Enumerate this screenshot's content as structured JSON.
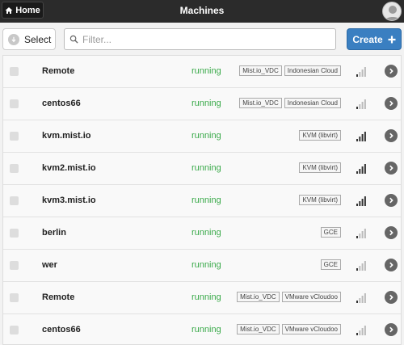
{
  "header": {
    "home_label": "Home",
    "title": "Machines",
    "avatar_icon": "user-avatar-icon"
  },
  "toolbar": {
    "select_label": "Select",
    "filter_placeholder": "Filter...",
    "create_label": "Create"
  },
  "colors": {
    "running": "#3aaa4a",
    "create": "#3a7fc1",
    "header": "#2b2b2b"
  },
  "machines": [
    {
      "name": "Remote",
      "state": "running",
      "tags": [
        "Mist.io_VDC",
        "Indonesian Cloud"
      ],
      "signal": 1
    },
    {
      "name": "centos66",
      "state": "running",
      "tags": [
        "Mist.io_VDC",
        "Indonesian Cloud"
      ],
      "signal": 1
    },
    {
      "name": "kvm.mist.io",
      "state": "running",
      "tags": [
        "KVM (libvirt)"
      ],
      "signal": 4
    },
    {
      "name": "kvm2.mist.io",
      "state": "running",
      "tags": [
        "KVM (libvirt)"
      ],
      "signal": 4
    },
    {
      "name": "kvm3.mist.io",
      "state": "running",
      "tags": [
        "KVM (libvirt)"
      ],
      "signal": 4
    },
    {
      "name": "berlin",
      "state": "running",
      "tags": [
        "GCE"
      ],
      "signal": 1
    },
    {
      "name": "wer",
      "state": "running",
      "tags": [
        "GCE"
      ],
      "signal": 1
    },
    {
      "name": "Remote",
      "state": "running",
      "tags": [
        "Mist.io_VDC",
        "VMware vCloudoo"
      ],
      "signal": 1
    },
    {
      "name": "centos66",
      "state": "running",
      "tags": [
        "Mist.io_VDC",
        "VMware vCloudoo"
      ],
      "signal": 1
    }
  ]
}
